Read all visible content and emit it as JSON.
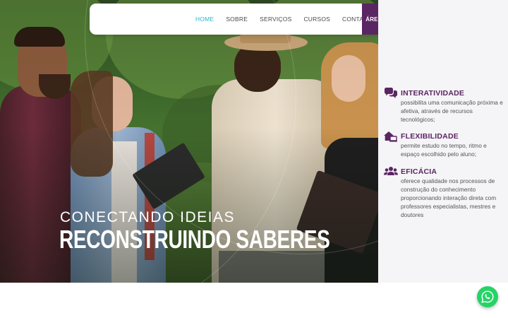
{
  "nav": {
    "items": [
      {
        "label": "HOME",
        "active": true
      },
      {
        "label": "SOBRE",
        "active": false
      },
      {
        "label": "SERVIÇOS",
        "active": false
      },
      {
        "label": "CURSOS",
        "active": false
      },
      {
        "label": "CONTATO",
        "active": false
      }
    ],
    "cta_label": "ÁREA DO ALUNO"
  },
  "hero": {
    "line1": "CONECTANDO IDEIAS",
    "line2": "RECONSTRUINDO SABERES"
  },
  "features": [
    {
      "icon": "chat-bubbles-icon",
      "title": "INTERATIVIDADE",
      "description": "possibilita uma comunicação próxima e afetiva, através de recursos tecnológicos;"
    },
    {
      "icon": "house-laptop-icon",
      "title": "FLEXIBILIDADE",
      "description": "permite estudo no tempo, ritmo e espaço escolhido pelo aluno;"
    },
    {
      "icon": "users-group-icon",
      "title": "EFICÁCIA",
      "description": "oferece qualidade nos processos de construção do conhecimento proporcionando interação direta com professores especialistas, mestres e doutores"
    }
  ],
  "colors": {
    "brand_purple": "#5a2563",
    "active_link": "#2bb5c9",
    "whatsapp_green": "#25d366",
    "panel_bg": "#f5f4f6"
  },
  "floating": {
    "icon": "whatsapp-icon"
  }
}
